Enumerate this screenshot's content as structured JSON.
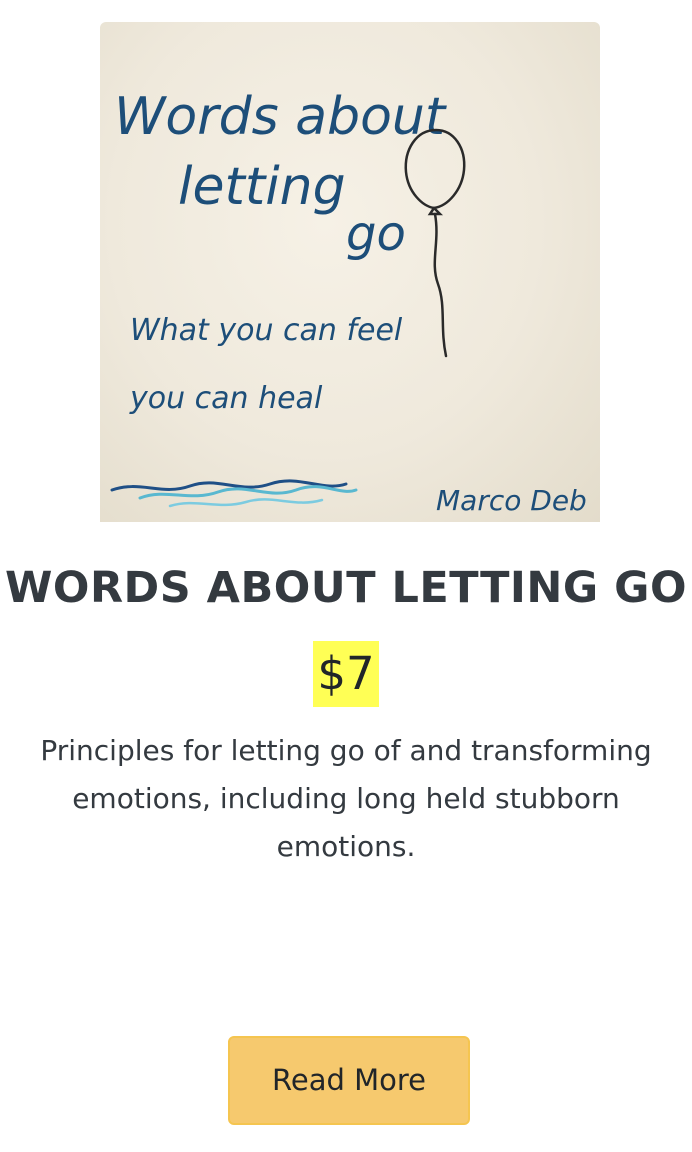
{
  "product": {
    "cover": {
      "title_line1": "Words about",
      "title_line2": "letting",
      "title_line3": "go",
      "subtitle_line1": "What you can feel",
      "subtitle_line2": "you can heal",
      "author": "Marco Deb"
    },
    "title": "WORDS ABOUT LETTING GO",
    "price": "$7",
    "description": "Principles for letting go of and transforming emotions, including long held stubborn emotions.",
    "read_more_label": "Read More"
  },
  "colors": {
    "price_highlight": "#ffff55",
    "button_bg": "#f6c96e",
    "button_border": "#f5c550",
    "text_dark": "#343a40"
  },
  "icons": {
    "balloon": "balloon-icon",
    "waves": "waves-icon"
  }
}
